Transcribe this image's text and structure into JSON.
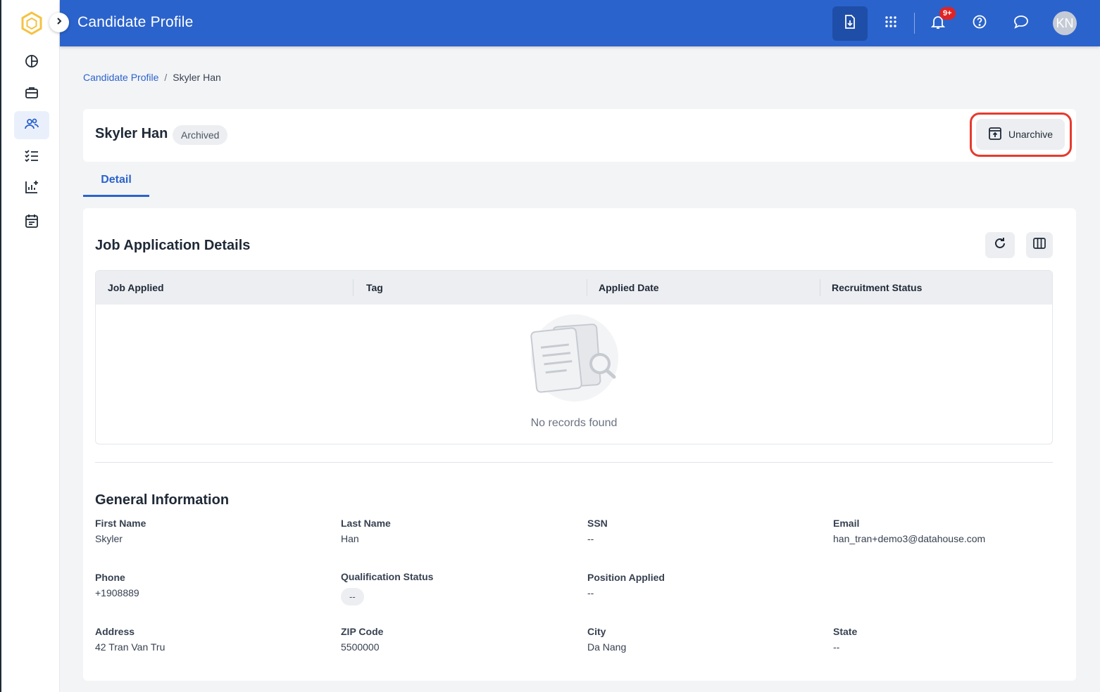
{
  "header": {
    "title": "Candidate Profile",
    "notification_count": "9+",
    "avatar_initials": "KN",
    "icons": [
      "download-doc-icon",
      "apps-grid-icon",
      "bell-icon",
      "help-icon",
      "chat-icon"
    ]
  },
  "sidebar": {
    "items": [
      {
        "name": "dashboard",
        "icon": "pie-chart-icon"
      },
      {
        "name": "jobs",
        "icon": "briefcase-icon"
      },
      {
        "name": "candidates",
        "icon": "users-icon",
        "active": true
      },
      {
        "name": "tasks",
        "icon": "checklist-icon"
      },
      {
        "name": "reports",
        "icon": "chart-add-icon"
      },
      {
        "name": "calendar",
        "icon": "calendar-icon"
      }
    ]
  },
  "breadcrumb": {
    "parent": "Candidate Profile",
    "separator": "/",
    "current": "Skyler Han"
  },
  "profile": {
    "name": "Skyler Han",
    "status": "Archived",
    "unarchive_label": "Unarchive"
  },
  "tabs": [
    {
      "label": "Detail",
      "active": true
    }
  ],
  "job_applications": {
    "title": "Job Application Details",
    "columns": [
      "Job Applied",
      "Tag",
      "Applied Date",
      "Recruitment Status"
    ],
    "rows": [],
    "empty_text": "No records found"
  },
  "general_info": {
    "title": "General Information",
    "fields": [
      {
        "label": "First Name",
        "value": "Skyler"
      },
      {
        "label": "Last Name",
        "value": "Han"
      },
      {
        "label": "SSN",
        "value": "--"
      },
      {
        "label": "Email",
        "value": "han_tran+demo3@datahouse.com"
      },
      {
        "label": "Phone",
        "value": "+1908889"
      },
      {
        "label": "Qualification Status",
        "value": "--"
      },
      {
        "label": "Position Applied",
        "value": "--"
      },
      {
        "label": "Address",
        "value": "42 Tran Van Tru"
      },
      {
        "label": "ZIP Code",
        "value": "5500000"
      },
      {
        "label": "City",
        "value": "Da Nang"
      },
      {
        "label": "State",
        "value": "--"
      }
    ]
  },
  "colors": {
    "primary": "#2b63cc",
    "highlight": "#e53b2e",
    "badge": "#e02424"
  }
}
